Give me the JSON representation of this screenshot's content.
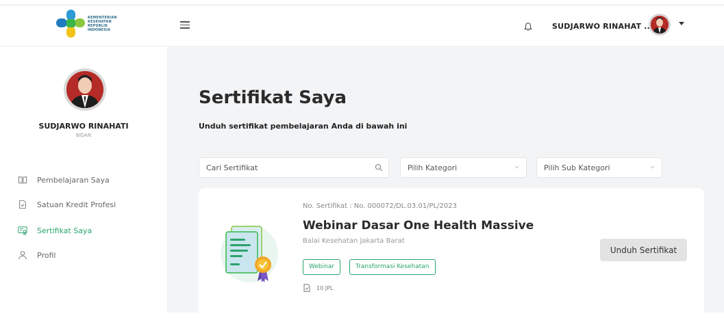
{
  "header": {
    "logo_text": [
      "KEMENTERIAN",
      "KESEHATAN",
      "REPUBLIK",
      "INDONESIA"
    ],
    "user_name": "SUDJARWO RINAHAT ...",
    "icons": {
      "menu": "hamburger-icon",
      "notification": "bell-icon",
      "dropdown": "caret-down-icon"
    }
  },
  "sidebar": {
    "profile_name": "SUDJARWO RINAHATI",
    "profile_role": "BIDAN",
    "items": [
      {
        "label": "Pembelajaran Saya",
        "icon": "book-open-icon",
        "active": false
      },
      {
        "label": "Satuan Kredit Profesi",
        "icon": "document-icon",
        "active": false
      },
      {
        "label": "Sertifikat Saya",
        "icon": "certificate-icon",
        "active": true
      },
      {
        "label": "Profil",
        "icon": "user-icon",
        "active": false
      }
    ]
  },
  "main": {
    "title": "Sertifikat Saya",
    "subtitle": "Unduh sertifikat pembelajaran Anda di bawah ini",
    "search_placeholder": "Cari Sertifikat",
    "category_placeholder": "Pilih Kategori",
    "subcategory_placeholder": "Pilih Sub Kategori"
  },
  "certificate": {
    "number": "No. Sertifikat : No. 000072/DL.03.01/PL/2023",
    "title": "Webinar Dasar One Health Massive",
    "organizer": "Balai Kesehatan Jakarta Barat",
    "tags": [
      "Webinar",
      "Transformasi Kesehatan"
    ],
    "jpl": "10 JPL",
    "download_label": "Unduh Sertifikat"
  },
  "colors": {
    "accent": "#2aa36a",
    "background": "#f3f4f6",
    "button": "#e3e3e3"
  }
}
